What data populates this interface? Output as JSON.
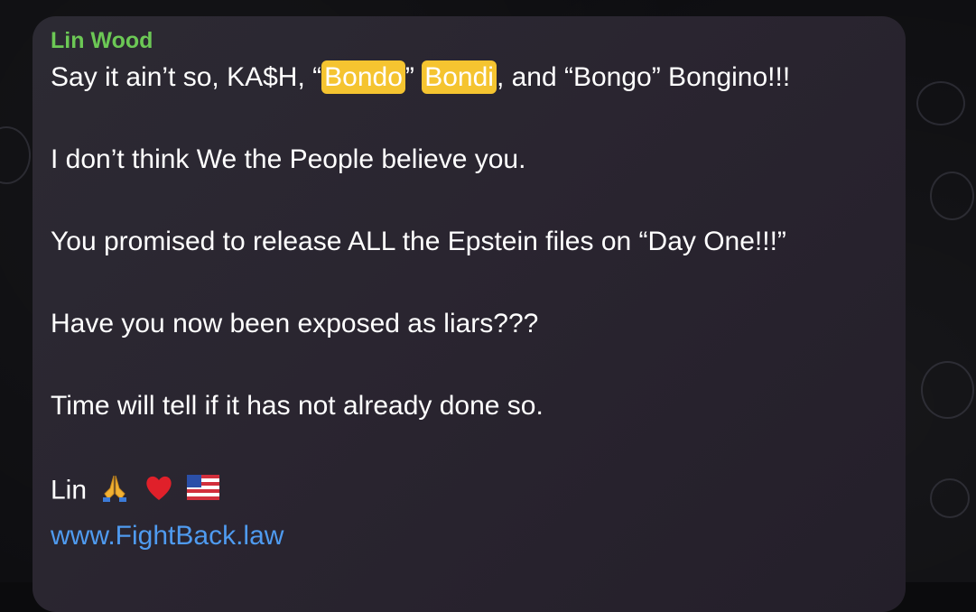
{
  "message": {
    "sender": "Lin Wood",
    "line1": {
      "prefix": "Say it ain’t so, KA$H, “",
      "highlight1": "Bondo",
      "mid": "” ",
      "highlight2": "Bondi",
      "suffix": ", and “Bongo” Bongino!!!"
    },
    "line2": "I don’t think We the People believe you.",
    "line3": "You promised to release ALL the Epstein files on “Day One!!!”",
    "line4": "Have you now been exposed as liars???",
    "line5": "Time will tell if it has not already done so.",
    "signature": "Lin",
    "signature_icons": [
      "praying-hands-icon",
      "red-heart-icon",
      "us-flag-icon"
    ],
    "link": "www.FightBack.law"
  },
  "colors": {
    "sender": "#6cc855",
    "highlight": "#f5c430",
    "link": "#4f9bf0",
    "bubble": "#2a2530",
    "background": "#0d0d10"
  }
}
